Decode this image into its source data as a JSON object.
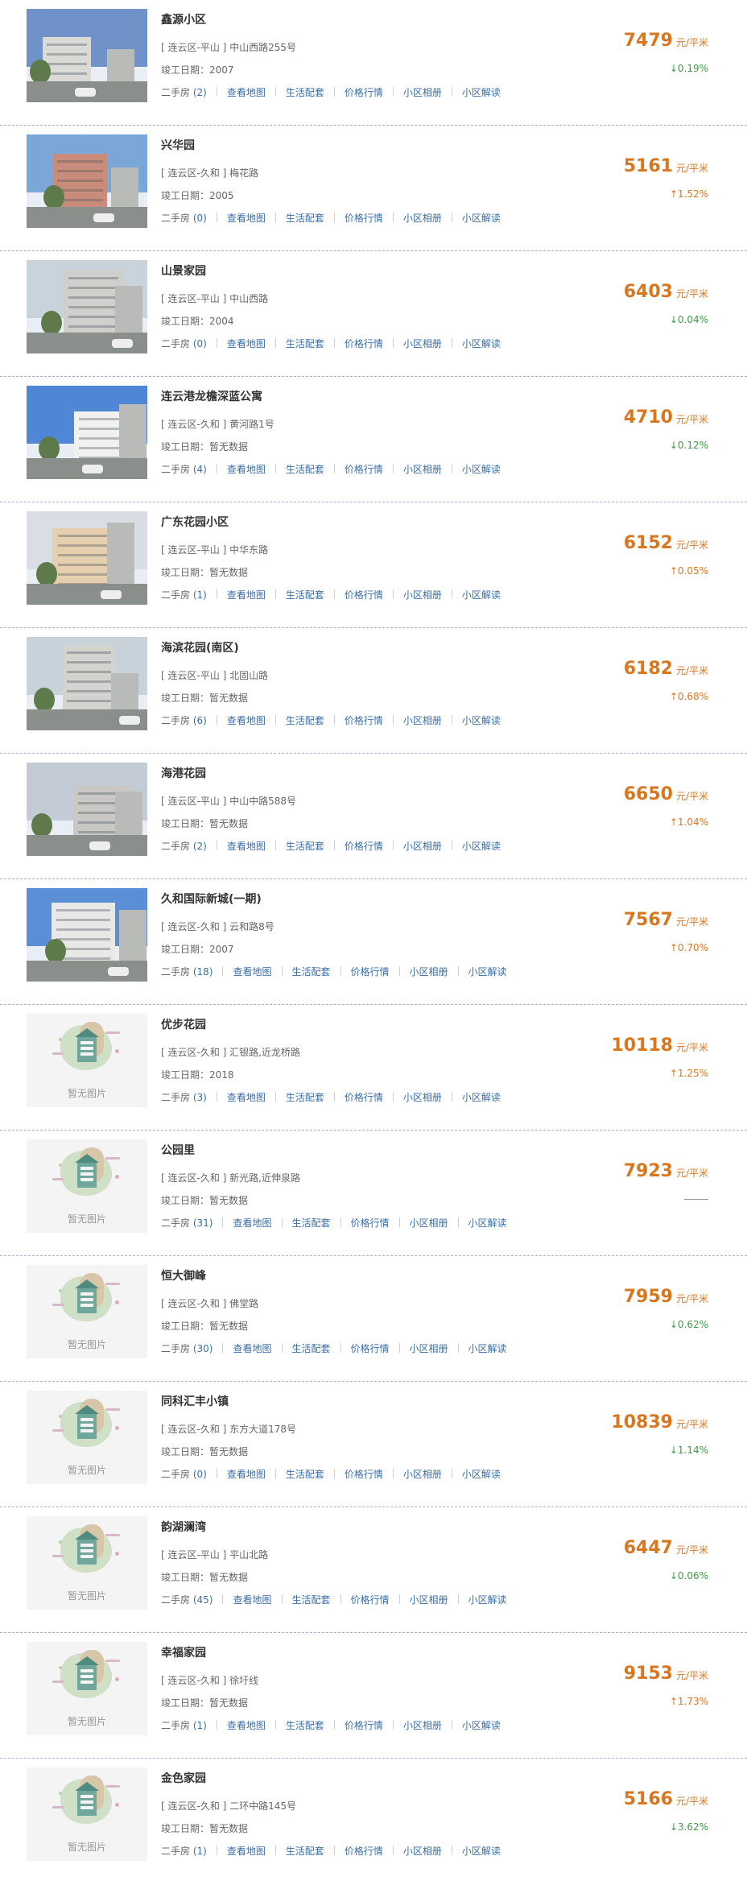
{
  "labels": {
    "built_prefix": "竣工日期：",
    "second_hand": "二手房",
    "link_map": "查看地图",
    "link_life": "生活配套",
    "link_price": "价格行情",
    "link_album": "小区相册",
    "link_read": "小区解读",
    "price_unit": "元/平米",
    "no_photo": "暂无图片"
  },
  "listings": [
    {
      "name": "鑫源小区",
      "district": "[ 连云区-平山 ]",
      "street": "中山西路255号",
      "built": "2007",
      "second_hand_count": "(2)",
      "price": "7479",
      "change_text": "↓0.19%",
      "trend": "down",
      "photo": true
    },
    {
      "name": "兴华园",
      "district": "[ 连云区-久和 ]",
      "street": "梅花路",
      "built": "2005",
      "second_hand_count": "(0)",
      "price": "5161",
      "change_text": "↑1.52%",
      "trend": "up",
      "photo": true
    },
    {
      "name": "山景家园",
      "district": "[ 连云区-平山 ]",
      "street": "中山西路",
      "built": "2004",
      "second_hand_count": "(0)",
      "price": "6403",
      "change_text": "↓0.04%",
      "trend": "down",
      "photo": true
    },
    {
      "name": "连云港龙檐深蓝公寓",
      "district": "[ 连云区-久和 ]",
      "street": "黄河路1号",
      "built": "暂无数据",
      "second_hand_count": "(4)",
      "price": "4710",
      "change_text": "↓0.12%",
      "trend": "down",
      "photo": true
    },
    {
      "name": "广东花园小区",
      "district": "[ 连云区-平山 ]",
      "street": "中华东路",
      "built": "暂无数据",
      "second_hand_count": "(1)",
      "price": "6152",
      "change_text": "↑0.05%",
      "trend": "up",
      "photo": true
    },
    {
      "name": "海滨花园(南区)",
      "district": "[ 连云区-平山 ]",
      "street": "北固山路",
      "built": "暂无数据",
      "second_hand_count": "(6)",
      "price": "6182",
      "change_text": "↑0.68%",
      "trend": "up",
      "photo": true
    },
    {
      "name": "海港花园",
      "district": "[ 连云区-平山 ]",
      "street": "中山中路588号",
      "built": "暂无数据",
      "second_hand_count": "(2)",
      "price": "6650",
      "change_text": "↑1.04%",
      "trend": "up",
      "photo": true
    },
    {
      "name": "久和国际新城(一期)",
      "district": "[ 连云区-久和 ]",
      "street": "云和路8号",
      "built": "2007",
      "second_hand_count": "(18)",
      "price": "7567",
      "change_text": "↑0.70%",
      "trend": "up",
      "photo": true
    },
    {
      "name": "优步花园",
      "district": "[ 连云区-久和 ]",
      "street": "汇银路,近龙桥路",
      "built": "2018",
      "second_hand_count": "(3)",
      "price": "10118",
      "change_text": "↑1.25%",
      "trend": "up",
      "photo": false
    },
    {
      "name": "公园里",
      "district": "[ 连云区-久和 ]",
      "street": "新光路,近伸泉路",
      "built": "暂无数据",
      "second_hand_count": "(31)",
      "price": "7923",
      "change_text": "",
      "trend": "flat",
      "photo": false
    },
    {
      "name": "恒大御峰",
      "district": "[ 连云区-久和 ]",
      "street": "佛堂路",
      "built": "暂无数据",
      "second_hand_count": "(30)",
      "price": "7959",
      "change_text": "↓0.62%",
      "trend": "down",
      "photo": false
    },
    {
      "name": "同科汇丰小镇",
      "district": "[ 连云区-久和 ]",
      "street": "东方大道178号",
      "built": "暂无数据",
      "second_hand_count": "(0)",
      "price": "10839",
      "change_text": "↓1.14%",
      "trend": "down",
      "photo": false
    },
    {
      "name": "韵湖澜湾",
      "district": "[ 连云区-平山 ]",
      "street": "平山北路",
      "built": "暂无数据",
      "second_hand_count": "(45)",
      "price": "6447",
      "change_text": "↓0.06%",
      "trend": "down",
      "photo": false
    },
    {
      "name": "幸福家园",
      "district": "[ 连云区-久和 ]",
      "street": "徐圩线",
      "built": "暂无数据",
      "second_hand_count": "(1)",
      "price": "9153",
      "change_text": "↑1.73%",
      "trend": "up",
      "photo": false
    },
    {
      "name": "金色家园",
      "district": "[ 连云区-久和 ]",
      "street": "二环中路145号",
      "built": "暂无数据",
      "second_hand_count": "(1)",
      "price": "5166",
      "change_text": "↓3.62%",
      "trend": "down",
      "photo": false
    }
  ],
  "colors": {
    "price": "#d9771f",
    "trend_up": "#d9771f",
    "trend_down": "#3e9b45",
    "link": "#3a6ea5",
    "divider": "#b5a9d3"
  },
  "icons": {
    "photo": "building-photo",
    "placeholder": "house-placeholder-icon"
  }
}
